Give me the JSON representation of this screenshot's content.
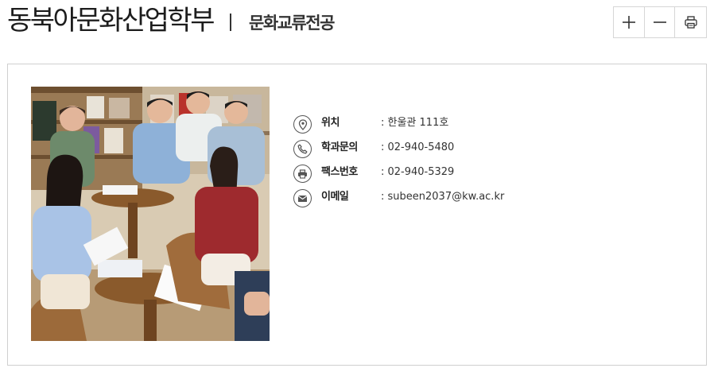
{
  "header": {
    "title": "동북아문화산업학부",
    "subtitle": "문화교류전공"
  },
  "tools": [
    {
      "name": "zoom-in",
      "icon": "plus-icon"
    },
    {
      "name": "zoom-out",
      "icon": "minus-icon"
    },
    {
      "name": "print",
      "icon": "printer-icon"
    }
  ],
  "info": {
    "location": {
      "icon": "map-pin-icon",
      "label": "위치",
      "value": ": 한울관 111호"
    },
    "phone": {
      "icon": "phone-icon",
      "label": "학과문의",
      "value": ": 02-940-5480"
    },
    "fax": {
      "icon": "fax-icon",
      "label": "팩스번호",
      "value": ": 02-940-5329"
    },
    "email": {
      "icon": "mail-icon",
      "label": "이메일",
      "value": ": subeen2037@kw.ac.kr"
    }
  },
  "colors": {
    "border": "#cfcfcf",
    "icon": "#555555",
    "text": "#222222"
  }
}
